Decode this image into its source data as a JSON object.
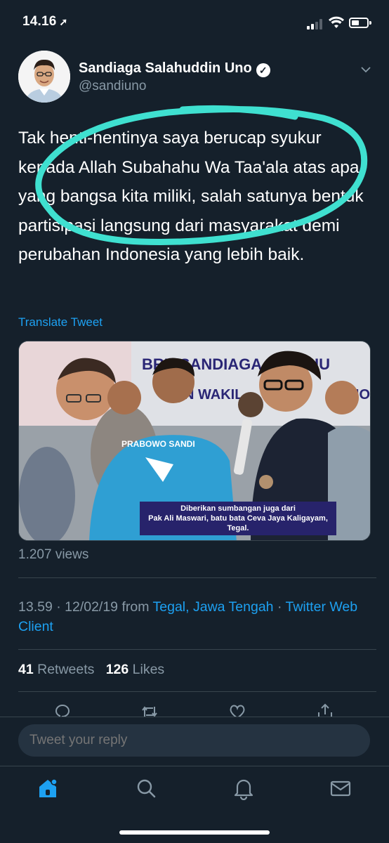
{
  "status_bar": {
    "time": "14.16",
    "location_arrow_icon": "location-arrow-icon"
  },
  "tweet": {
    "author_name": "Sandiaga Salahuddin Uno",
    "author_handle": "@sandiuno",
    "verified": true,
    "text": "Tak henti-hentinya saya berucap syukur kepada Allah Subahahu Wa Taa'ala atas apa yang bangsa kita miliki, salah satunya bentuk partisipasi langsung dari masyarakat demi perubahan Indonesia yang lebih baik.",
    "translate_label": "Translate Tweet",
    "media": {
      "banner_text_1": "BRK SANDIAGA SALAHU",
      "banner_text_2": "N WAKIL",
      "banner_text_3": "NO",
      "shirt_text": "PRABOWO SANDI",
      "caption_line_1": "Diberikan sumbangan juga dari",
      "caption_line_2": "Pak Ali Maswari, batu bata Ceva Jaya Kaligayam, Tegal."
    },
    "views": "1.207 views",
    "timestamp": "13.59 · 12/02/19 from ",
    "location": "Tegal, Jawa Tengah",
    "separator": " · ",
    "client": "Twitter Web Client",
    "retweets_count": "41",
    "retweets_label": "Retweets",
    "likes_count": "126",
    "likes_label": "Likes"
  },
  "reply": {
    "placeholder": "Tweet your reply"
  },
  "colors": {
    "background": "#15202b",
    "accent": "#1da1f2",
    "secondary_text": "#8899a6",
    "annotation": "#3fe0d0"
  },
  "tabs": [
    {
      "name": "home",
      "icon": "home-icon"
    },
    {
      "name": "search",
      "icon": "search-icon"
    },
    {
      "name": "notifications",
      "icon": "bell-icon"
    },
    {
      "name": "messages",
      "icon": "mail-icon"
    }
  ]
}
